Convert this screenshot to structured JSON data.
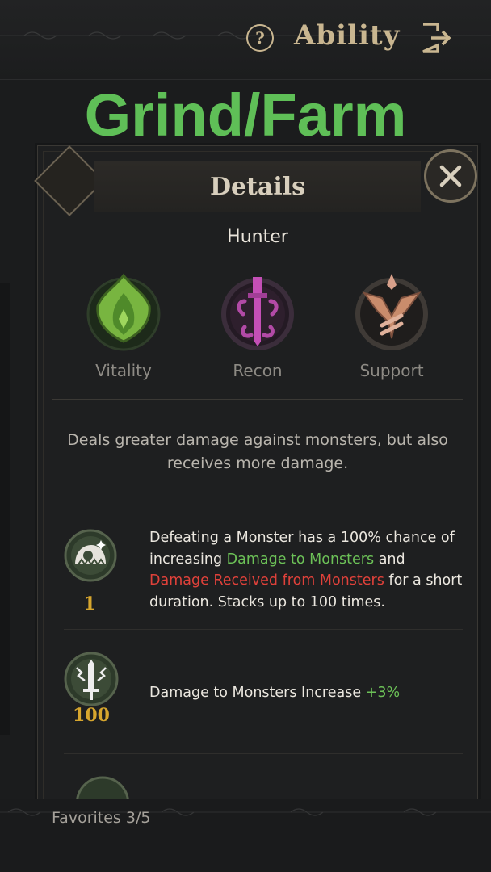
{
  "header": {
    "help_glyph": "?",
    "title": "Ability",
    "exit_icon": "exit-icon"
  },
  "overlay": {
    "caption": "Grind/Farm"
  },
  "panel": {
    "title": "Details",
    "class_name": "Hunter",
    "stats": [
      {
        "label": "Vitality",
        "icon": "vitality-icon",
        "color": "#6fae3f"
      },
      {
        "label": "Recon",
        "icon": "recon-icon",
        "color": "#b24aa6"
      },
      {
        "label": "Support",
        "icon": "support-icon",
        "color": "#c98c6c"
      }
    ],
    "description": "Deals greater damage against monsters, but also receives more damage.",
    "abilities": [
      {
        "icon": "monster-stack-icon",
        "level": "1",
        "text_parts": [
          "Defeating a Monster has a 100% chance of increasing ",
          "Damage to Monsters",
          " and ",
          "Damage Received from Monsters",
          " for a short duration. Stacks up to 100 times."
        ]
      },
      {
        "icon": "sword-icon",
        "level": "100",
        "text": "Damage to Monsters Increase ",
        "bonus": "+3%"
      }
    ]
  },
  "footer": {
    "favorites": "Favorites 3/5"
  },
  "colors": {
    "accent_gold": "#c9b690",
    "green_highlight": "#6cc157",
    "red_highlight": "#e0413a",
    "overlay_green": "#5fbf57"
  }
}
